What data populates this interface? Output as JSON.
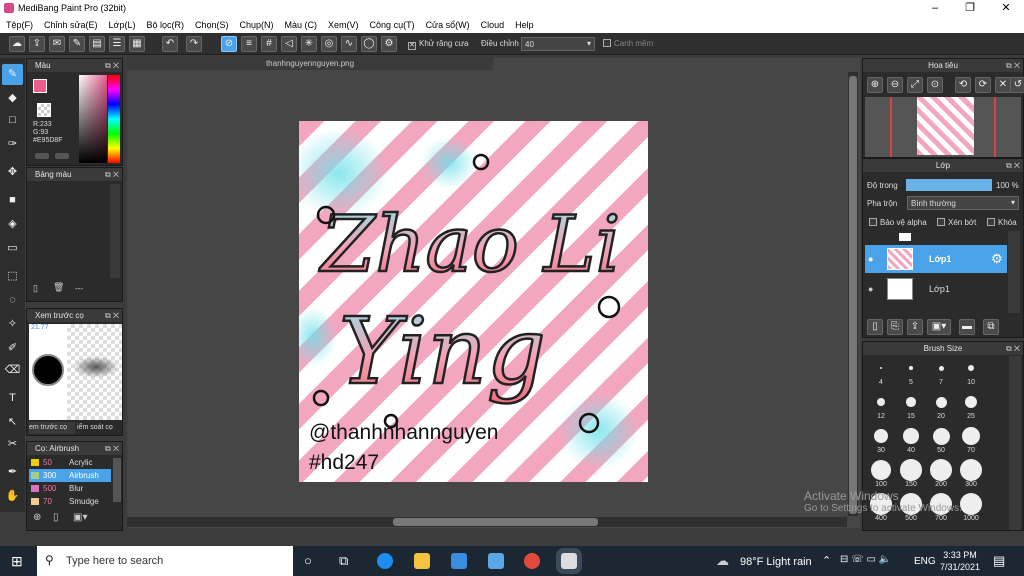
{
  "window": {
    "title": "MediBang Paint Pro (32bit)",
    "minimize": "–",
    "maximize": "❐",
    "close": "✕"
  },
  "menu": [
    "Tệp(F)",
    "Chỉnh sửa(E)",
    "Lớp(L)",
    "Bộ lọc(R)",
    "Chọn(S)",
    "Chụp(N)",
    "Màu (C)",
    "Xem(V)",
    "Công cụ(T)",
    "Cửa sổ(W)",
    "Cloud",
    "Help"
  ],
  "toolbar": {
    "antialias_label": "Khử răng cưa",
    "adjust_label": "Điều chỉnh",
    "adjust_value": "40",
    "soft_edge_label": "Canh mềm"
  },
  "document": {
    "tab_title": "thanhnguyennguyen.png",
    "art_title_1": "Zhao Li",
    "art_title_2": "Ying",
    "signature_1": "@thanhnhannguyen",
    "signature_2": "#hd247"
  },
  "color_panel": {
    "title": "Màu",
    "r": "R:233",
    "g": "G:93",
    "hex": "#E95D8F",
    "primary": "#e95d8f"
  },
  "palette_panel": {
    "title": "Bảng màu",
    "more": "---"
  },
  "preview_panel": {
    "title": "Xem trước cọ",
    "size": "21.77",
    "tab1": "em trước cọ",
    "tab2": "iểm soát cọ"
  },
  "brush_list": {
    "title": "Cọ: Airbrush",
    "items": [
      {
        "size": "50",
        "name": "Acrylic",
        "color": "#f0d000"
      },
      {
        "size": "300",
        "name": "Airbrush",
        "color": "#aacc88"
      },
      {
        "size": "500",
        "name": "Blur",
        "color": "#e070c0"
      },
      {
        "size": "70",
        "name": "Smudge",
        "color": "#f0c890"
      }
    ]
  },
  "navigator": {
    "title": "Hoa tiêu"
  },
  "layers": {
    "title": "Lớp",
    "opacity_label": "Độ trong",
    "opacity_value": "100 %",
    "blend_label": "Pha trộn",
    "blend_value": "Bình thường",
    "protect_alpha": "Bảo vệ alpha",
    "clipping": "Xén bớt",
    "lock": "Khóa",
    "items": [
      {
        "name": "Lớp1",
        "selected": true
      },
      {
        "name": "Lớp1",
        "selected": false
      }
    ]
  },
  "brush_size": {
    "title": "Brush Size",
    "sizes": [
      "4",
      "5",
      "7",
      "10",
      "12",
      "15",
      "20",
      "25",
      "30",
      "40",
      "50",
      "70",
      "100",
      "150",
      "200",
      "300",
      "400",
      "500",
      "700",
      "1000"
    ]
  },
  "watermark": {
    "line1": "Activate Windows",
    "line2": "Go to Settings to activate Windows."
  },
  "taskbar": {
    "search_placeholder": "Type here to search",
    "weather": "98°F  Light rain",
    "lang": "ENG",
    "time": "3:33 PM",
    "date": "7/31/2021"
  }
}
